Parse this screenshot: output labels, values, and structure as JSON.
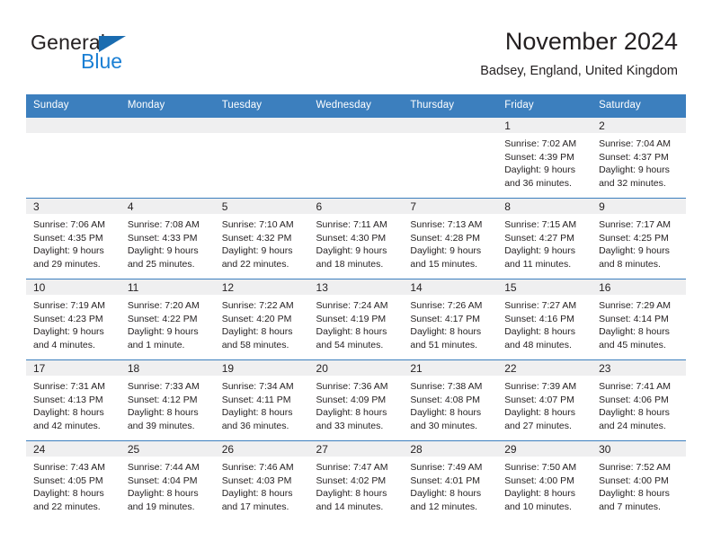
{
  "brand": {
    "word1": "General",
    "word2": "Blue",
    "triangle_color": "#1a6cb0",
    "blue_color": "#1a7fd4"
  },
  "header": {
    "title": "November 2024",
    "subtitle": "Badsey, England, United Kingdom"
  },
  "theme": {
    "header_blue": "#3c7fbe",
    "daynum_band": "#efeff0",
    "text": "#231f20"
  },
  "weekdays": [
    "Sunday",
    "Monday",
    "Tuesday",
    "Wednesday",
    "Thursday",
    "Friday",
    "Saturday"
  ],
  "labels": {
    "sunrise": "Sunrise:",
    "sunset": "Sunset:",
    "daylight": "Daylight:"
  },
  "weeks": [
    [
      {
        "day": "",
        "empty": true
      },
      {
        "day": "",
        "empty": true
      },
      {
        "day": "",
        "empty": true
      },
      {
        "day": "",
        "empty": true
      },
      {
        "day": "",
        "empty": true
      },
      {
        "day": "1",
        "sunrise": "Sunrise: 7:02 AM",
        "sunset": "Sunset: 4:39 PM",
        "daylight1": "Daylight: 9 hours",
        "daylight2": "and 36 minutes."
      },
      {
        "day": "2",
        "sunrise": "Sunrise: 7:04 AM",
        "sunset": "Sunset: 4:37 PM",
        "daylight1": "Daylight: 9 hours",
        "daylight2": "and 32 minutes."
      }
    ],
    [
      {
        "day": "3",
        "sunrise": "Sunrise: 7:06 AM",
        "sunset": "Sunset: 4:35 PM",
        "daylight1": "Daylight: 9 hours",
        "daylight2": "and 29 minutes."
      },
      {
        "day": "4",
        "sunrise": "Sunrise: 7:08 AM",
        "sunset": "Sunset: 4:33 PM",
        "daylight1": "Daylight: 9 hours",
        "daylight2": "and 25 minutes."
      },
      {
        "day": "5",
        "sunrise": "Sunrise: 7:10 AM",
        "sunset": "Sunset: 4:32 PM",
        "daylight1": "Daylight: 9 hours",
        "daylight2": "and 22 minutes."
      },
      {
        "day": "6",
        "sunrise": "Sunrise: 7:11 AM",
        "sunset": "Sunset: 4:30 PM",
        "daylight1": "Daylight: 9 hours",
        "daylight2": "and 18 minutes."
      },
      {
        "day": "7",
        "sunrise": "Sunrise: 7:13 AM",
        "sunset": "Sunset: 4:28 PM",
        "daylight1": "Daylight: 9 hours",
        "daylight2": "and 15 minutes."
      },
      {
        "day": "8",
        "sunrise": "Sunrise: 7:15 AM",
        "sunset": "Sunset: 4:27 PM",
        "daylight1": "Daylight: 9 hours",
        "daylight2": "and 11 minutes."
      },
      {
        "day": "9",
        "sunrise": "Sunrise: 7:17 AM",
        "sunset": "Sunset: 4:25 PM",
        "daylight1": "Daylight: 9 hours",
        "daylight2": "and 8 minutes."
      }
    ],
    [
      {
        "day": "10",
        "sunrise": "Sunrise: 7:19 AM",
        "sunset": "Sunset: 4:23 PM",
        "daylight1": "Daylight: 9 hours",
        "daylight2": "and 4 minutes."
      },
      {
        "day": "11",
        "sunrise": "Sunrise: 7:20 AM",
        "sunset": "Sunset: 4:22 PM",
        "daylight1": "Daylight: 9 hours",
        "daylight2": "and 1 minute."
      },
      {
        "day": "12",
        "sunrise": "Sunrise: 7:22 AM",
        "sunset": "Sunset: 4:20 PM",
        "daylight1": "Daylight: 8 hours",
        "daylight2": "and 58 minutes."
      },
      {
        "day": "13",
        "sunrise": "Sunrise: 7:24 AM",
        "sunset": "Sunset: 4:19 PM",
        "daylight1": "Daylight: 8 hours",
        "daylight2": "and 54 minutes."
      },
      {
        "day": "14",
        "sunrise": "Sunrise: 7:26 AM",
        "sunset": "Sunset: 4:17 PM",
        "daylight1": "Daylight: 8 hours",
        "daylight2": "and 51 minutes."
      },
      {
        "day": "15",
        "sunrise": "Sunrise: 7:27 AM",
        "sunset": "Sunset: 4:16 PM",
        "daylight1": "Daylight: 8 hours",
        "daylight2": "and 48 minutes."
      },
      {
        "day": "16",
        "sunrise": "Sunrise: 7:29 AM",
        "sunset": "Sunset: 4:14 PM",
        "daylight1": "Daylight: 8 hours",
        "daylight2": "and 45 minutes."
      }
    ],
    [
      {
        "day": "17",
        "sunrise": "Sunrise: 7:31 AM",
        "sunset": "Sunset: 4:13 PM",
        "daylight1": "Daylight: 8 hours",
        "daylight2": "and 42 minutes."
      },
      {
        "day": "18",
        "sunrise": "Sunrise: 7:33 AM",
        "sunset": "Sunset: 4:12 PM",
        "daylight1": "Daylight: 8 hours",
        "daylight2": "and 39 minutes."
      },
      {
        "day": "19",
        "sunrise": "Sunrise: 7:34 AM",
        "sunset": "Sunset: 4:11 PM",
        "daylight1": "Daylight: 8 hours",
        "daylight2": "and 36 minutes."
      },
      {
        "day": "20",
        "sunrise": "Sunrise: 7:36 AM",
        "sunset": "Sunset: 4:09 PM",
        "daylight1": "Daylight: 8 hours",
        "daylight2": "and 33 minutes."
      },
      {
        "day": "21",
        "sunrise": "Sunrise: 7:38 AM",
        "sunset": "Sunset: 4:08 PM",
        "daylight1": "Daylight: 8 hours",
        "daylight2": "and 30 minutes."
      },
      {
        "day": "22",
        "sunrise": "Sunrise: 7:39 AM",
        "sunset": "Sunset: 4:07 PM",
        "daylight1": "Daylight: 8 hours",
        "daylight2": "and 27 minutes."
      },
      {
        "day": "23",
        "sunrise": "Sunrise: 7:41 AM",
        "sunset": "Sunset: 4:06 PM",
        "daylight1": "Daylight: 8 hours",
        "daylight2": "and 24 minutes."
      }
    ],
    [
      {
        "day": "24",
        "sunrise": "Sunrise: 7:43 AM",
        "sunset": "Sunset: 4:05 PM",
        "daylight1": "Daylight: 8 hours",
        "daylight2": "and 22 minutes."
      },
      {
        "day": "25",
        "sunrise": "Sunrise: 7:44 AM",
        "sunset": "Sunset: 4:04 PM",
        "daylight1": "Daylight: 8 hours",
        "daylight2": "and 19 minutes."
      },
      {
        "day": "26",
        "sunrise": "Sunrise: 7:46 AM",
        "sunset": "Sunset: 4:03 PM",
        "daylight1": "Daylight: 8 hours",
        "daylight2": "and 17 minutes."
      },
      {
        "day": "27",
        "sunrise": "Sunrise: 7:47 AM",
        "sunset": "Sunset: 4:02 PM",
        "daylight1": "Daylight: 8 hours",
        "daylight2": "and 14 minutes."
      },
      {
        "day": "28",
        "sunrise": "Sunrise: 7:49 AM",
        "sunset": "Sunset: 4:01 PM",
        "daylight1": "Daylight: 8 hours",
        "daylight2": "and 12 minutes."
      },
      {
        "day": "29",
        "sunrise": "Sunrise: 7:50 AM",
        "sunset": "Sunset: 4:00 PM",
        "daylight1": "Daylight: 8 hours",
        "daylight2": "and 10 minutes."
      },
      {
        "day": "30",
        "sunrise": "Sunrise: 7:52 AM",
        "sunset": "Sunset: 4:00 PM",
        "daylight1": "Daylight: 8 hours",
        "daylight2": "and 7 minutes."
      }
    ]
  ]
}
